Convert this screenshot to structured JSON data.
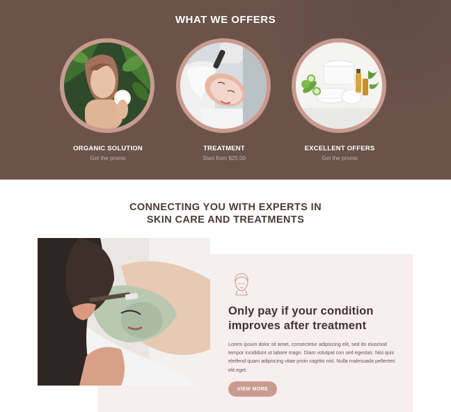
{
  "offers": {
    "title": "WHAT WE OFFERS",
    "items": [
      {
        "name": "ORGANIC SOLUTION",
        "sub": "Get the promo",
        "image": "woman-with-leaves-and-cream-jar"
      },
      {
        "name": "TREATMENT",
        "sub": "Start from $25.00",
        "image": "woman-receiving-facial-mask"
      },
      {
        "name": "EXCELLENT OFFERS",
        "sub": "Get the promo",
        "image": "skincare-jars-with-cucumber"
      }
    ]
  },
  "experts": {
    "title_line1": "CONNECTING YOU WITH EXPERTS IN",
    "title_line2": "SKIN CARE AND TREATMENTS",
    "icon": "face-outline-icon",
    "headline_line1": "Only pay if your condition",
    "headline_line2": "improves after treatment",
    "body": "Lorem ipsum dolor sit amet, consectetur adipiscing elit, sed do eiusmod tempor incididunt ut labore magn. Diam volutpat con sed egestas. Nisi quis eleifend quam adipiscing vitae proin sagittis nisl. Nulla malesuada pellentes elit eget.",
    "button_label": "VIEW MORE",
    "photo": "facial-mask-application"
  },
  "colors": {
    "brown_band": "#6b534a",
    "accent_pink": "#c99a8f",
    "panel_pink": "#f7efee",
    "heading_dark": "#4c3a34"
  }
}
